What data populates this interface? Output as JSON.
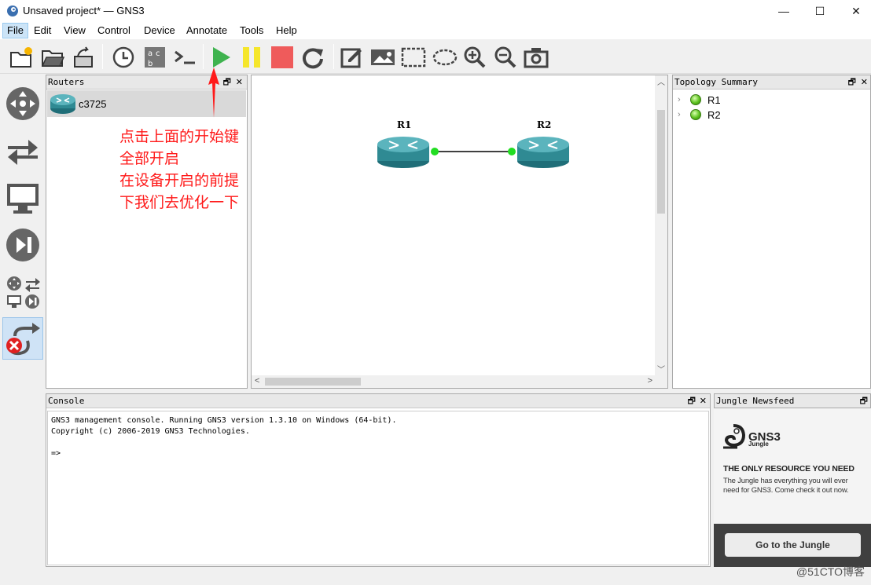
{
  "window": {
    "title": "Unsaved project* — GNS3",
    "minimize": "—",
    "maximize": "☐",
    "close": "✕"
  },
  "menu": [
    "File",
    "Edit",
    "View",
    "Control",
    "Device",
    "Annotate",
    "Tools",
    "Help"
  ],
  "toolbar": {
    "buttons": [
      "new-project",
      "open-project",
      "save-project",
      "snapshot",
      "show-interface-labels",
      "console-all",
      "start-all",
      "suspend-all",
      "stop-all",
      "reload-all",
      "add-note",
      "insert-picture",
      "draw-rectangle",
      "draw-ellipse",
      "zoom-in",
      "zoom-out",
      "screenshot"
    ]
  },
  "devices": [
    "routers",
    "switches",
    "end-devices",
    "security-devices",
    "all-devices",
    "add-link"
  ],
  "routers_panel": {
    "title": "Routers",
    "items": [
      {
        "label": "c3725"
      }
    ]
  },
  "annotation": {
    "lines": [
      "点击上面的开始键",
      "全部开启",
      "在设备开启的前提",
      "下我们去优化一下"
    ]
  },
  "topology": {
    "nodes": [
      {
        "label": "R1"
      },
      {
        "label": "R2"
      }
    ]
  },
  "topology_summary": {
    "title": "Topology Summary",
    "items": [
      {
        "label": "R1"
      },
      {
        "label": "R2"
      }
    ]
  },
  "console": {
    "title": "Console",
    "lines": [
      "GNS3 management console. Running GNS3 version 1.3.10 on Windows (64-bit).",
      "Copyright (c) 2006-2019 GNS3 Technologies.",
      "",
      "=>"
    ]
  },
  "jungle": {
    "title": "Jungle Newsfeed",
    "logo_text": "GNS3",
    "logo_sub": "Jungle",
    "headline": "THE ONLY RESOURCE YOU NEED",
    "body": "The Jungle has everything you will ever need for GNS3. Come check it out now.",
    "button": "Go to the Jungle"
  },
  "watermark": "@51CTO博客",
  "colors": {
    "annotation_red": "#ff1a1a",
    "start_green": "#3fb34f",
    "pause_yellow": "#f5e62b",
    "stop_red": "#ef5b5b",
    "router_teal": "#2f8a93",
    "link_led_green": "#22dd22"
  }
}
